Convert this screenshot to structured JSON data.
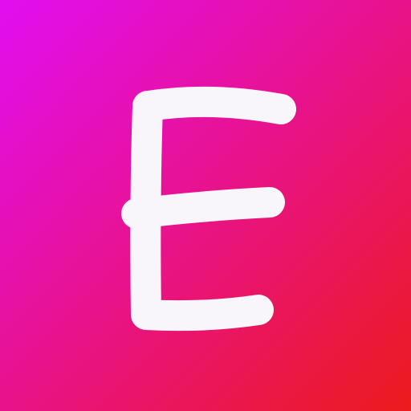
{
  "icon": {
    "letter": "E",
    "colors": {
      "gradient_start": "#E20EF2",
      "gradient_mid": "#E9137F",
      "gradient_end": "#EC1B1B",
      "glyph": "#F8F6FA"
    }
  }
}
